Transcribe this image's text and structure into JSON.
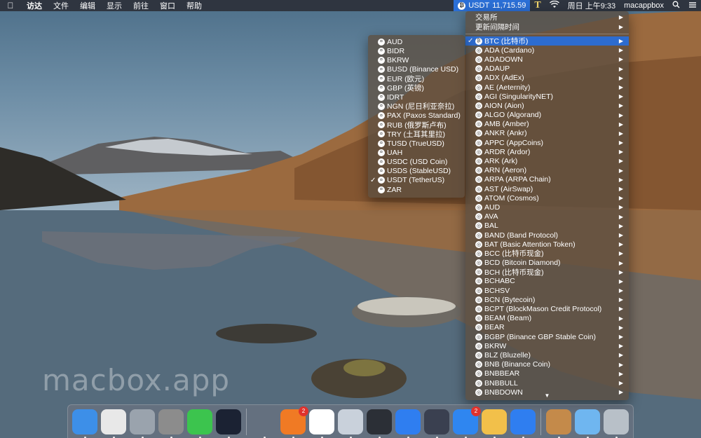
{
  "menubar": {
    "app_menus": [
      "访达",
      "文件",
      "编辑",
      "显示",
      "前往",
      "窗口",
      "帮助"
    ],
    "ticker_pair": "USDT",
    "ticker_price": "11,715.59",
    "clock": "周日 上午9:33",
    "username": "macappbox"
  },
  "main_menu": {
    "header_items": [
      "交易所",
      "更新间隔时间"
    ],
    "selected": "BTC (比特币)",
    "coins": [
      "ADA (Cardano)",
      "ADADOWN",
      "ADAUP",
      "ADX (AdEx)",
      "AE (Aeternity)",
      "AGI (SingularityNET)",
      "AION (Aion)",
      "ALGO (Algorand)",
      "AMB (Amber)",
      "ANKR (Ankr)",
      "APPC (AppCoins)",
      "ARDR (Ardor)",
      "ARK (Ark)",
      "ARN (Aeron)",
      "ARPA (ARPA Chain)",
      "AST (AirSwap)",
      "ATOM (Cosmos)",
      "AUD",
      "AVA",
      "BAL",
      "BAND (Band Protocol)",
      "BAT (Basic Attention Token)",
      "BCC (比特币现金)",
      "BCD (Bitcoin Diamond)",
      "BCH (比特币现金)",
      "BCHABC",
      "BCHSV",
      "BCN (Bytecoin)",
      "BCPT (BlockMason Credit Protocol)",
      "BEAM (Beam)",
      "BEAR",
      "BGBP (Binance GBP Stable Coin)",
      "BKRW",
      "BLZ (Bluzelle)",
      "BNB (Binance Coin)",
      "BNBBEAR",
      "BNBBULL",
      "BNBDOWN"
    ]
  },
  "sub_menu": {
    "selected": "USDT (TetherUS)",
    "currencies": [
      "AUD",
      "BIDR",
      "BKRW",
      "BUSD (Binance USD)",
      "EUR (欧元)",
      "GBP (英镑)",
      "IDRT",
      "NGN (尼日利亚奈拉)",
      "PAX (Paxos Standard)",
      "RUB (俄罗斯卢布)",
      "TRY (土耳其里拉)",
      "TUSD (TrueUSD)",
      "UAH",
      "USDC (USD Coin)",
      "USDS (StableUSD)",
      "USDT (TetherUS)",
      "ZAR"
    ]
  },
  "watermark": "macbox.app",
  "dock": {
    "apps": [
      {
        "name": "finder-icon",
        "color": "#3d8fe8"
      },
      {
        "name": "chrome-icon",
        "color": "#e8e8e8"
      },
      {
        "name": "launchpad-icon",
        "color": "#9aa3ad"
      },
      {
        "name": "system-preferences-icon",
        "color": "#8c8c8c"
      },
      {
        "name": "wechat-icon",
        "color": "#3cc44e"
      },
      {
        "name": "cloud-icon",
        "color": "#1b2233"
      },
      {
        "name": "qq-icon",
        "color": "transparent"
      },
      {
        "name": "firefox-icon",
        "color": "#f07a24",
        "badge": "2"
      },
      {
        "name": "baidu-netdisk-icon",
        "color": "#ffffff"
      },
      {
        "name": "printer-icon",
        "color": "#c9d1db"
      },
      {
        "name": "code-editor-icon",
        "color": "#2b2f36"
      },
      {
        "name": "messages-icon",
        "color": "#2f7ef0"
      },
      {
        "name": "monitor-icon",
        "color": "#3a4050"
      },
      {
        "name": "app-store-icon",
        "color": "#2f86f0",
        "badge": "2"
      },
      {
        "name": "truck-icon",
        "color": "#f2c04a"
      },
      {
        "name": "location-icon",
        "color": "#2f7ef0"
      },
      {
        "name": "archive-icon",
        "color": "#c48a4a"
      },
      {
        "name": "folder-icon",
        "color": "#6fb6f0"
      },
      {
        "name": "trash-icon",
        "color": "#b8c0c8"
      }
    ]
  }
}
